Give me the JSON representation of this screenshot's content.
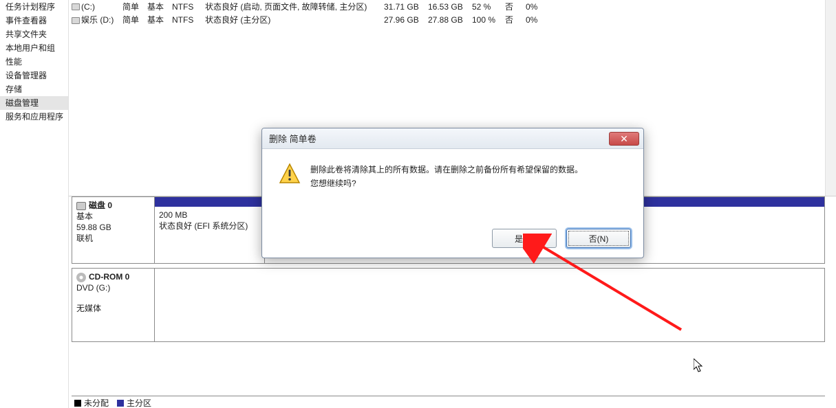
{
  "sidebar": {
    "items": [
      {
        "label": "任务计划程序"
      },
      {
        "label": "事件查看器"
      },
      {
        "label": "共享文件夹"
      },
      {
        "label": "本地用户和组"
      },
      {
        "label": "性能"
      },
      {
        "label": "设备管理器"
      },
      {
        "label": "存储"
      },
      {
        "label": "磁盘管理"
      },
      {
        "label": "服务和应用程序"
      }
    ],
    "selected_index": 7
  },
  "volumes": [
    {
      "name": "(C:)",
      "layout": "简单",
      "type": "基本",
      "fs": "NTFS",
      "status": "状态良好 (启动, 页面文件, 故障转储, 主分区)",
      "capacity": "31.71 GB",
      "free": "16.53 GB",
      "pct_free": "52 %",
      "fault": "否",
      "overhead": "0%"
    },
    {
      "name": "娱乐 (D:)",
      "layout": "简单",
      "type": "基本",
      "fs": "NTFS",
      "status": "状态良好 (主分区)",
      "capacity": "27.96 GB",
      "free": "27.88 GB",
      "pct_free": "100 %",
      "fault": "否",
      "overhead": "0%"
    }
  ],
  "disk0": {
    "title": "磁盘 0",
    "kind": "基本",
    "size": "59.88 GB",
    "state": "联机",
    "part0": {
      "size": "200 MB",
      "status": "状态良好 (EFI 系统分区)"
    }
  },
  "cdrom": {
    "title": "CD-ROM 0",
    "drive": "DVD (G:)",
    "state": "无媒体"
  },
  "legend": {
    "item0": "未分配",
    "item1": "主分区"
  },
  "dialog": {
    "title": "删除 简单卷",
    "message_line1": "删除此卷将清除其上的所有数据。请在删除之前备份所有希望保留的数据。",
    "message_line2": "您想继续吗?",
    "yes": "是(Y)",
    "no": "否(N)"
  },
  "icons": {
    "close_x": "✕"
  }
}
